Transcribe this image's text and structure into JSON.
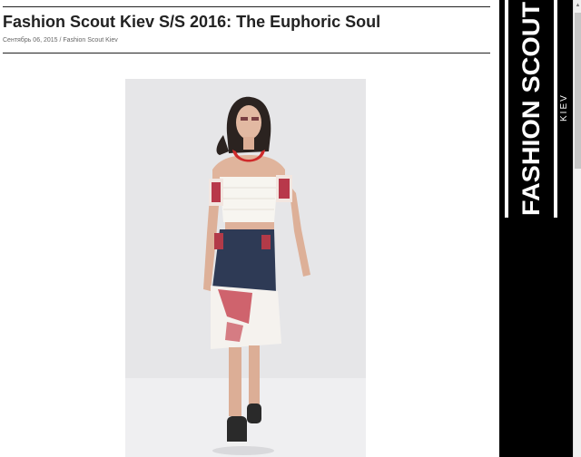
{
  "article": {
    "title": "Fashion Scout Kiev S/S 2016: The Euphoric Soul",
    "date": "Сентябрь 06, 2015",
    "separator": " / ",
    "category": "Fashion Scout Kiev"
  },
  "sidebar": {
    "logo_main": "FASHION SCOUT",
    "logo_sub": "KIEV"
  },
  "colors": {
    "sidebar_bg": "#000000",
    "logo_text": "#ffffff",
    "title_text": "#222222"
  },
  "icons": {
    "scroll_up": "▲"
  }
}
